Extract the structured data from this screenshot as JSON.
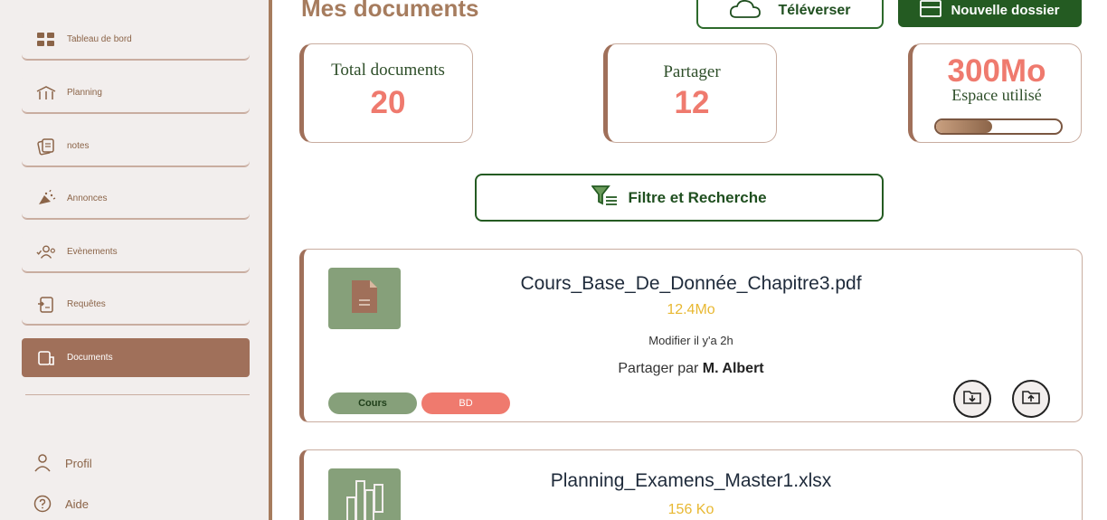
{
  "sidebar": {
    "items": [
      {
        "label": "Tableau de bord",
        "icon": "grid-icon"
      },
      {
        "label": "Planning",
        "icon": "planning-icon"
      },
      {
        "label": "notes",
        "icon": "notes-icon"
      },
      {
        "label": "Annonces",
        "icon": "megaphone-icon"
      },
      {
        "label": "Evènements",
        "icon": "people-icon"
      },
      {
        "label": "Requêtes",
        "icon": "request-icon"
      },
      {
        "label": "Documents",
        "icon": "document-icon",
        "active": true
      }
    ],
    "bottom": [
      {
        "label": "Profil",
        "icon": "user-icon"
      },
      {
        "label": "Aide",
        "icon": "help-icon"
      }
    ]
  },
  "header": {
    "title": "Mes documents",
    "upload_label": "Téléverser",
    "new_folder_label": "Nouvelle dossier"
  },
  "stats": {
    "total_label": "Total documents",
    "total_value": "20",
    "shared_label": "Partager",
    "shared_value": "12",
    "space_value": "300Mo",
    "space_label": "Espace utilisé",
    "space_fraction": 0.45
  },
  "filter": {
    "label": "Filtre et Recherche"
  },
  "documents": [
    {
      "name": "Cours_Base_De_Donnée_Chapitre3.pdf",
      "size": "12.4Mo",
      "modified": "Modifier il y'a 2h",
      "shared_prefix": "Partager par",
      "shared_by": "M. Albert",
      "tags": [
        "Cours",
        "BD"
      ]
    },
    {
      "name": "Planning_Examens_Master1.xlsx",
      "size": "156 Ko"
    }
  ],
  "colors": {
    "brand_brown": "#a0705a",
    "brand_green": "#245b22",
    "accent_coral": "#ef7a6e",
    "accent_yellow": "#e8b832"
  }
}
